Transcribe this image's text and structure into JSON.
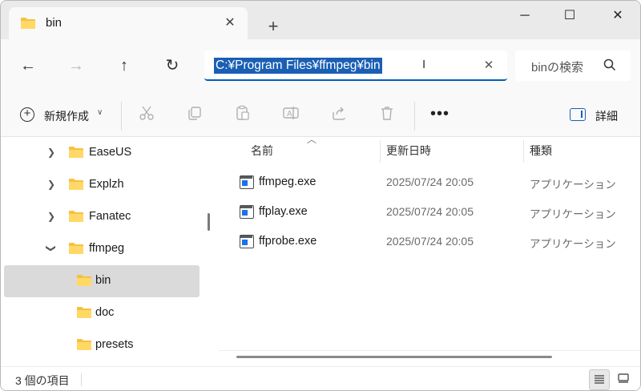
{
  "window": {
    "tab_title": "bin",
    "tab_close": "✕",
    "new_tab": "+",
    "minimize": "─",
    "maximize": "☐",
    "close": "✕"
  },
  "nav": {
    "back": "←",
    "forward": "→",
    "up": "↑",
    "refresh": "↻"
  },
  "address": {
    "path": "C:¥Program Files¥ffmpeg¥bin",
    "clear": "✕"
  },
  "search": {
    "placeholder": "binの検索"
  },
  "toolbar": {
    "new_label": "新規作成",
    "more": "•••",
    "details_label": "詳細",
    "icons": [
      "cut-icon",
      "copy-icon",
      "paste-icon",
      "rename-icon",
      "share-icon",
      "delete-icon"
    ]
  },
  "tree": {
    "items": [
      {
        "label": "EaseUS",
        "expanded": false,
        "level": 1
      },
      {
        "label": "Explzh",
        "expanded": false,
        "level": 1
      },
      {
        "label": "Fanatec",
        "expanded": false,
        "level": 1
      },
      {
        "label": "ffmpeg",
        "expanded": true,
        "level": 1
      },
      {
        "label": "bin",
        "selected": true,
        "level": 2
      },
      {
        "label": "doc",
        "level": 2
      },
      {
        "label": "presets",
        "level": 2
      }
    ]
  },
  "filelist": {
    "columns": [
      "名前",
      "更新日時",
      "種類"
    ],
    "rows": [
      {
        "name": "ffmpeg.exe",
        "date": "2025/07/24 20:05",
        "type": "アプリケーション"
      },
      {
        "name": "ffplay.exe",
        "date": "2025/07/24 20:05",
        "type": "アプリケーション"
      },
      {
        "name": "ffprobe.exe",
        "date": "2025/07/24 20:05",
        "type": "アプリケーション"
      }
    ]
  },
  "status": {
    "item_count": "3 個の項目"
  },
  "colors": {
    "accent": "#005fb8",
    "selection": "#1a5fb4",
    "folder": "#f6c142",
    "selected_row": "#dadada"
  }
}
